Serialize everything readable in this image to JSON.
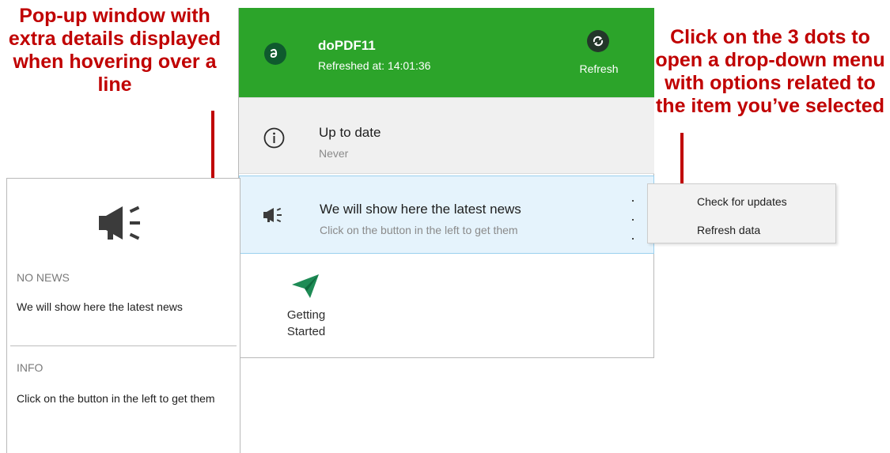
{
  "annotations": {
    "left": "Pop-up window with extra details displayed when hovering over a line",
    "right": "Click on the 3 dots to open a drop-down menu with options related to the item you’ve selected"
  },
  "header": {
    "app_name": "doPDF11",
    "refreshed": "Refreshed at: 14:01:36",
    "refresh_label": "Refresh",
    "bg_color": "#2ca42a"
  },
  "status": {
    "title": "Up to date",
    "subtitle": "Never",
    "icon": "info-icon"
  },
  "news": {
    "title": "We will show here the latest news",
    "subtitle": "Click on the button in the left to get them",
    "icon": "megaphone-icon"
  },
  "getting_started": {
    "label": "Getting Started",
    "icon": "paper-plane-icon"
  },
  "popup": {
    "section1_title": "NO NEWS",
    "section1_text": "We will show here the latest news",
    "section2_title": "INFO",
    "section2_text": "Click on the button in the left to get them"
  },
  "menu": {
    "items": [
      "Check for updates",
      "Refresh data"
    ]
  },
  "colors": {
    "annotation": "#c00000",
    "selected_row": "#e5f3fc",
    "accent": "#2ca42a"
  }
}
